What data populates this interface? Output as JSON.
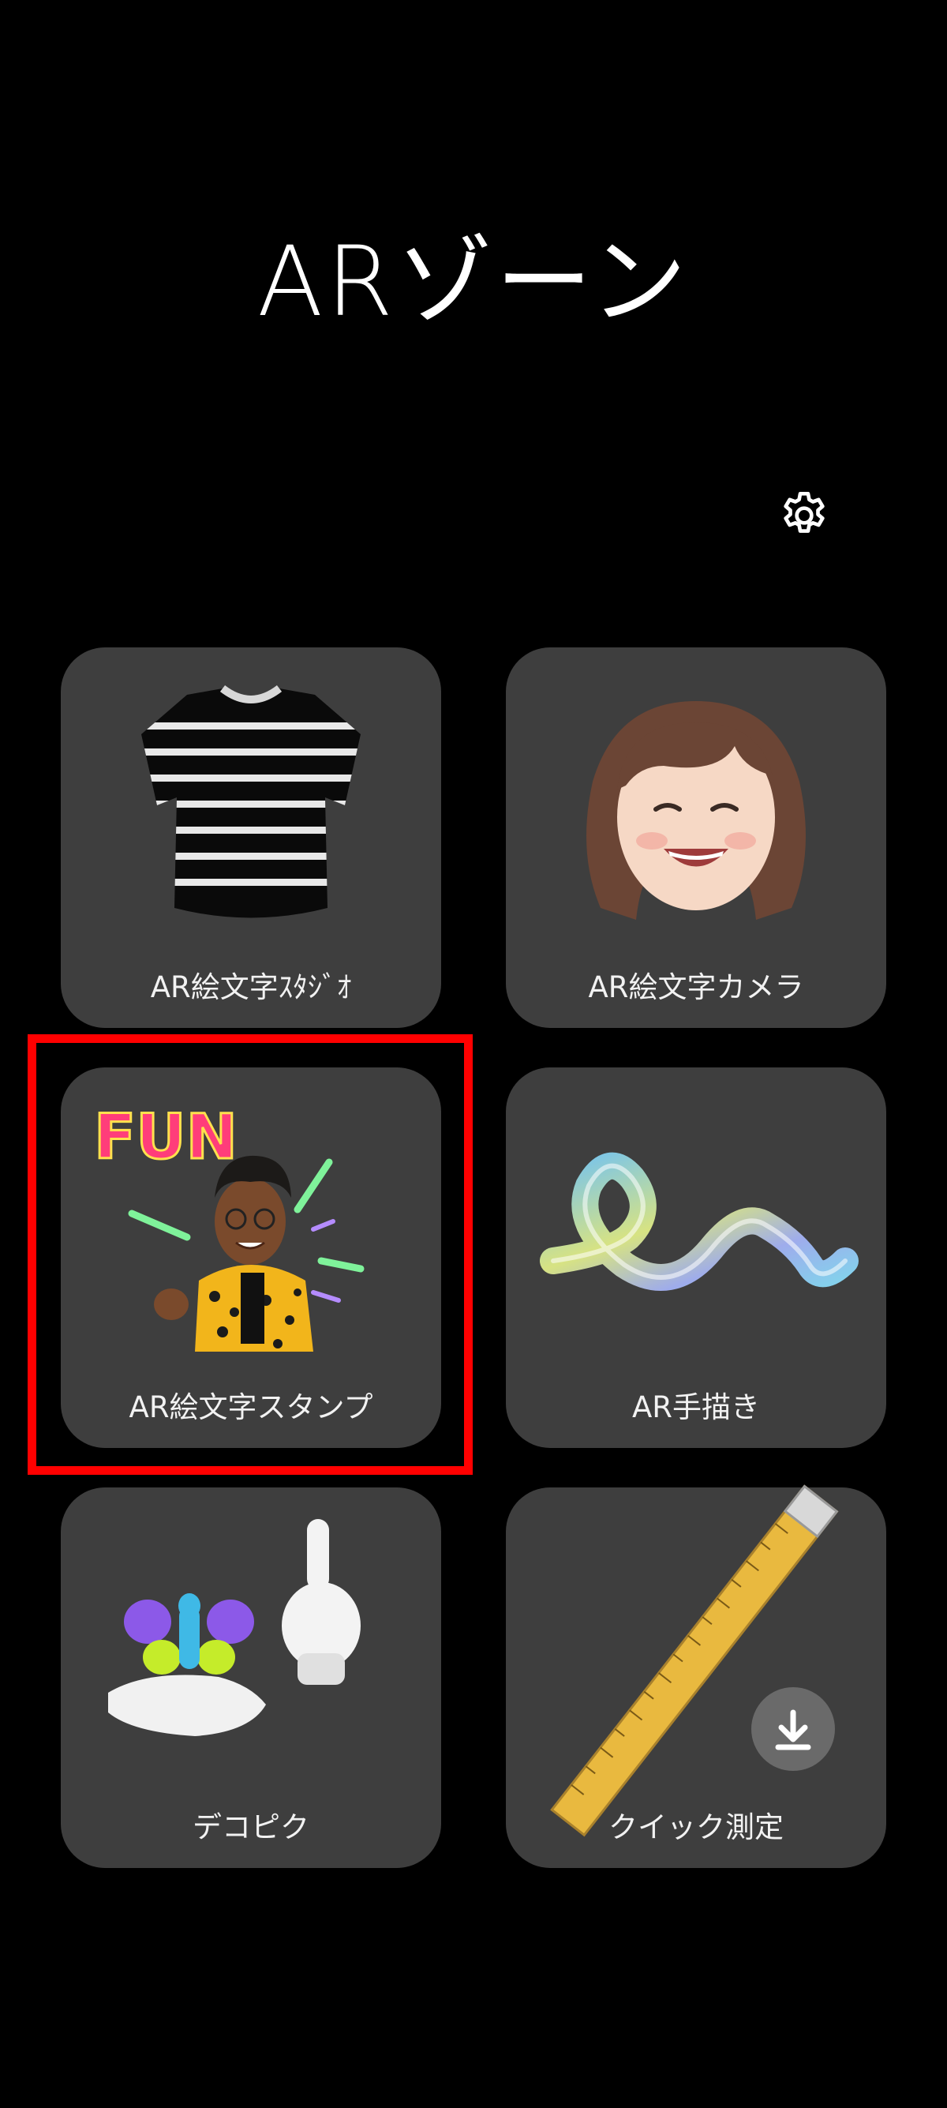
{
  "header": {
    "title": "ARゾーン"
  },
  "tiles": [
    {
      "label": "AR絵文字ｽﾀｼﾞｵ",
      "icon": "striped-tshirt"
    },
    {
      "label": "AR絵文字カメラ",
      "icon": "smiling-girl-avatar"
    },
    {
      "label": "AR絵文字スタンプ",
      "icon": "fun-sticker-avatar",
      "highlighted": true,
      "sticker_text": "FUN"
    },
    {
      "label": "AR手描き",
      "icon": "3d-squiggle"
    },
    {
      "label": "デコピク",
      "icon": "balloon-hand-and-pointing-glove"
    },
    {
      "label": "クイック測定",
      "icon": "measuring-tape",
      "has_download_badge": true
    }
  ],
  "colors": {
    "background": "#000000",
    "tile": "#3e3e3e",
    "highlight": "#ff0000"
  }
}
